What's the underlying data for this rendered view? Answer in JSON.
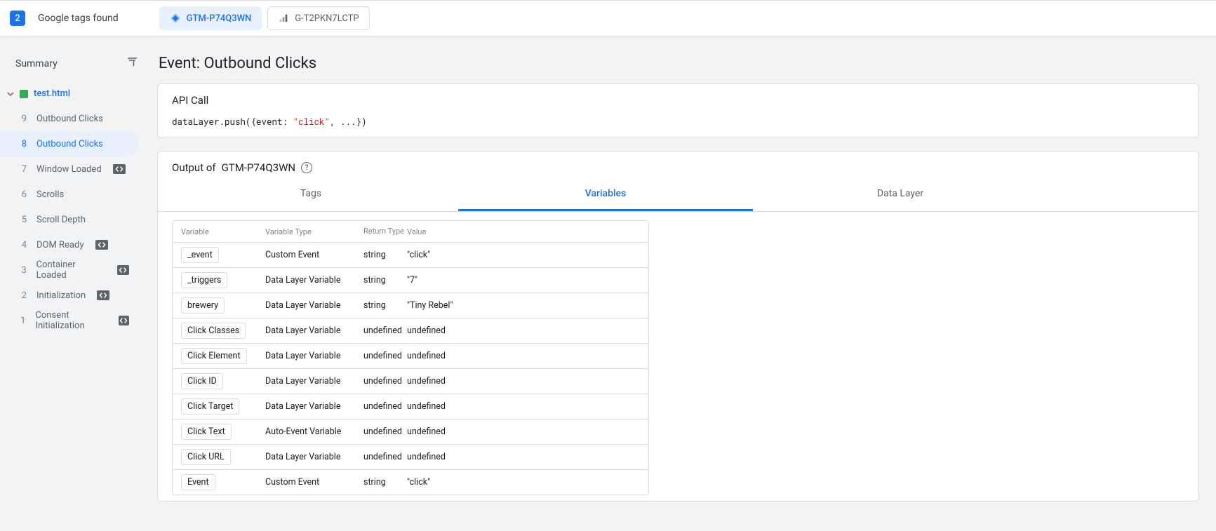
{
  "topbar": {
    "count": "2",
    "title": "Google tags found",
    "chips": [
      {
        "id": "gtm",
        "label": "GTM-P74Q3WN",
        "active": true
      },
      {
        "id": "ga",
        "label": "G-T2PKN7LCTP",
        "active": false
      }
    ]
  },
  "sidebar": {
    "summary_label": "Summary",
    "page_label": "test.html",
    "events": [
      {
        "num": "9",
        "label": "Outbound Clicks",
        "badge": false,
        "selected": false
      },
      {
        "num": "8",
        "label": "Outbound Clicks",
        "badge": false,
        "selected": true
      },
      {
        "num": "7",
        "label": "Window Loaded",
        "badge": true,
        "selected": false
      },
      {
        "num": "6",
        "label": "Scrolls",
        "badge": false,
        "selected": false
      },
      {
        "num": "5",
        "label": "Scroll Depth",
        "badge": false,
        "selected": false
      },
      {
        "num": "4",
        "label": "DOM Ready",
        "badge": true,
        "selected": false
      },
      {
        "num": "3",
        "label": "Container Loaded",
        "badge": true,
        "selected": false
      },
      {
        "num": "2",
        "label": "Initialization",
        "badge": true,
        "selected": false
      },
      {
        "num": "1",
        "label": "Consent Initialization",
        "badge": true,
        "selected": false
      }
    ]
  },
  "main": {
    "event_title": "Event: Outbound Clicks",
    "api_call": {
      "title": "API Call",
      "code_prefix": "dataLayer.push({event: ",
      "code_string": "\"click\"",
      "code_suffix": ", ...})"
    },
    "output": {
      "title_prefix": "Output of ",
      "container_id": "GTM-P74Q3WN",
      "tabs": [
        {
          "id": "tags",
          "label": "Tags",
          "active": false
        },
        {
          "id": "variables",
          "label": "Variables",
          "active": true
        },
        {
          "id": "datalayer",
          "label": "Data Layer",
          "active": false
        }
      ],
      "table": {
        "headers": {
          "variable": "Variable",
          "type": "Variable Type",
          "return": "Return Type",
          "value": "Value"
        },
        "rows": [
          {
            "name": "_event",
            "type": "Custom Event",
            "return": "string",
            "value": "\"click\""
          },
          {
            "name": "_triggers",
            "type": "Data Layer Variable",
            "return": "string",
            "value": "\"7\""
          },
          {
            "name": "brewery",
            "type": "Data Layer Variable",
            "return": "string",
            "value": "\"Tiny Rebel\""
          },
          {
            "name": "Click Classes",
            "type": "Data Layer Variable",
            "return": "undefined",
            "value": "undefined"
          },
          {
            "name": "Click Element",
            "type": "Data Layer Variable",
            "return": "undefined",
            "value": "undefined"
          },
          {
            "name": "Click ID",
            "type": "Data Layer Variable",
            "return": "undefined",
            "value": "undefined"
          },
          {
            "name": "Click Target",
            "type": "Data Layer Variable",
            "return": "undefined",
            "value": "undefined"
          },
          {
            "name": "Click Text",
            "type": "Auto-Event Variable",
            "return": "undefined",
            "value": "undefined"
          },
          {
            "name": "Click URL",
            "type": "Data Layer Variable",
            "return": "undefined",
            "value": "undefined"
          },
          {
            "name": "Event",
            "type": "Custom Event",
            "return": "string",
            "value": "\"click\""
          }
        ]
      }
    }
  }
}
